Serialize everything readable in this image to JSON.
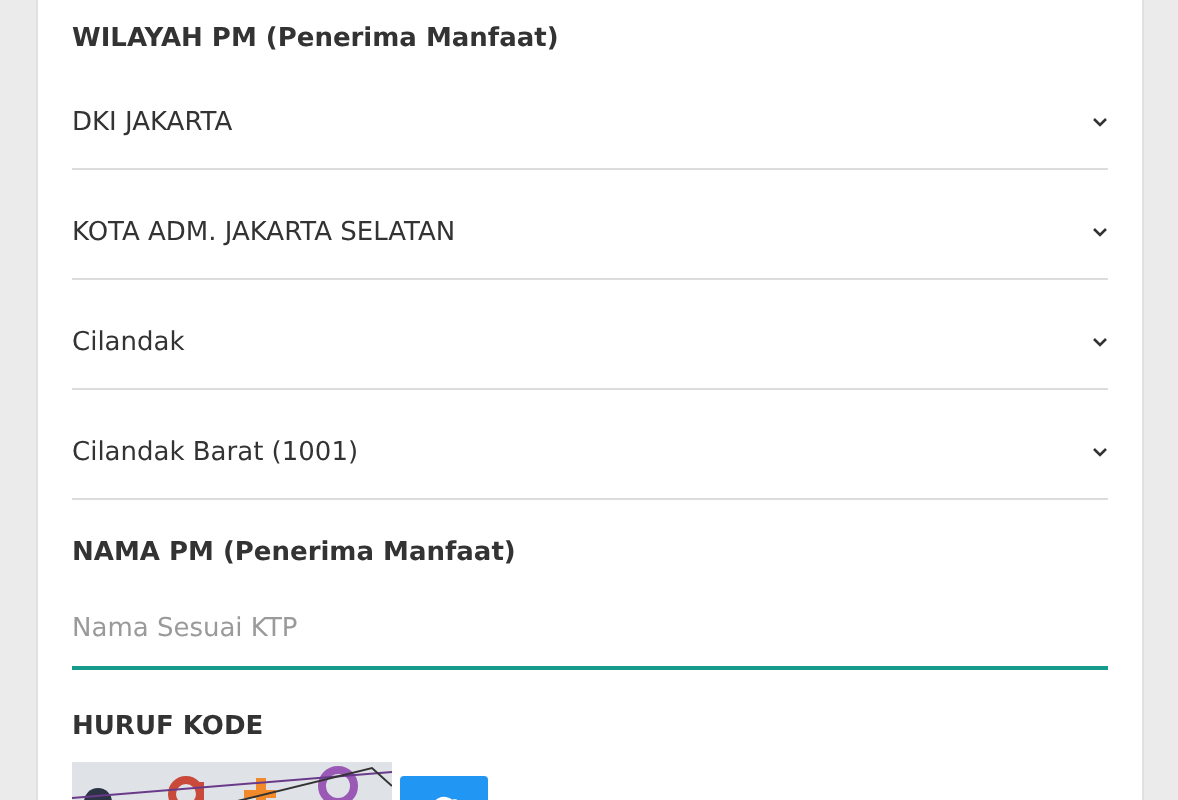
{
  "region_section": {
    "label": "WILAYAH PM (Penerima Manfaat)",
    "selects": [
      {
        "value": "DKI JAKARTA"
      },
      {
        "value": "KOTA ADM. JAKARTA SELATAN"
      },
      {
        "value": "Cilandak"
      },
      {
        "value": "Cilandak Barat (1001)"
      }
    ]
  },
  "name_section": {
    "label": "NAMA PM (Penerima Manfaat)",
    "placeholder": "Nama Sesuai KTP",
    "focused": true
  },
  "captcha_section": {
    "label": "HURUF KODE"
  }
}
